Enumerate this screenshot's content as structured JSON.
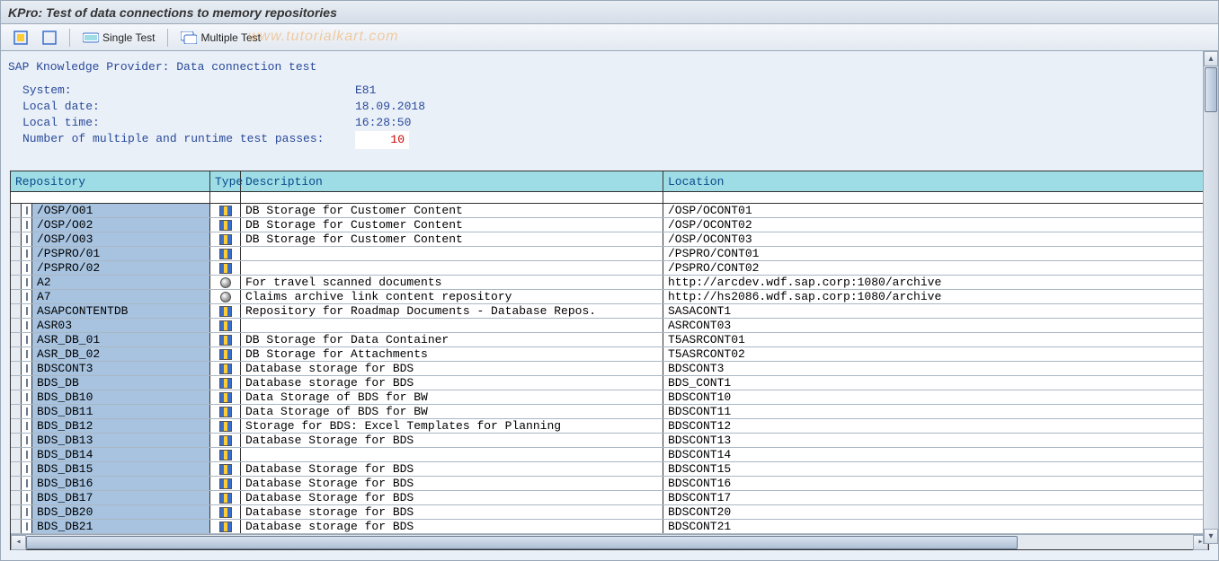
{
  "title": "KPro: Test of data connections to memory repositories",
  "watermark": "www.tutorialkart.com",
  "toolbar": {
    "single": "Single Test",
    "multiple": "Multiple Test"
  },
  "section_title": "SAP Knowledge Provider: Data connection test",
  "info": {
    "system_label": "System:",
    "system_value": "E81",
    "date_label": "Local date:",
    "date_value": "18.09.2018",
    "time_label": "Local time:",
    "time_value": "16:28:50",
    "passes_label": "Number of multiple and runtime test passes:",
    "passes_value": "10"
  },
  "columns": {
    "repo": "Repository",
    "type": "Type",
    "desc": "Description",
    "loc": "Location"
  },
  "rows": [
    {
      "repo": "/OSP/O01",
      "type": "db",
      "desc": "DB Storage for Customer Content",
      "loc": "/OSP/OCONT01"
    },
    {
      "repo": "/OSP/O02",
      "type": "db",
      "desc": "DB Storage for Customer Content",
      "loc": "/OSP/OCONT02"
    },
    {
      "repo": "/OSP/O03",
      "type": "db",
      "desc": "DB Storage for Customer Content",
      "loc": "/OSP/OCONT03"
    },
    {
      "repo": "/PSPRO/01",
      "type": "db",
      "desc": "",
      "loc": "/PSPRO/CONT01"
    },
    {
      "repo": "/PSPRO/02",
      "type": "db",
      "desc": "",
      "loc": "/PSPRO/CONT02"
    },
    {
      "repo": "A2",
      "type": "arc",
      "desc": "For travel scanned documents",
      "loc": "http://arcdev.wdf.sap.corp:1080/archive"
    },
    {
      "repo": "A7",
      "type": "arc",
      "desc": "Claims archive link content repository",
      "loc": "http://hs2086.wdf.sap.corp:1080/archive"
    },
    {
      "repo": "ASAPCONTENTDB",
      "type": "db",
      "desc": "Repository for Roadmap Documents - Database Repos.",
      "loc": "SASACONT1"
    },
    {
      "repo": "ASR03",
      "type": "db",
      "desc": "",
      "loc": "ASRCONT03"
    },
    {
      "repo": "ASR_DB_01",
      "type": "db",
      "desc": "DB Storage for Data Container",
      "loc": "T5ASRCONT01"
    },
    {
      "repo": "ASR_DB_02",
      "type": "db",
      "desc": "DB Storage for Attachments",
      "loc": "T5ASRCONT02"
    },
    {
      "repo": "BDSCONT3",
      "type": "db",
      "desc": "Database storage for BDS",
      "loc": "BDSCONT3"
    },
    {
      "repo": "BDS_DB",
      "type": "db",
      "desc": "Database storage for BDS",
      "loc": "BDS_CONT1"
    },
    {
      "repo": "BDS_DB10",
      "type": "db",
      "desc": "Data Storage of BDS for BW",
      "loc": "BDSCONT10"
    },
    {
      "repo": "BDS_DB11",
      "type": "db",
      "desc": "Data Storage of BDS for BW",
      "loc": "BDSCONT11"
    },
    {
      "repo": "BDS_DB12",
      "type": "db",
      "desc": "Storage for BDS: Excel Templates for Planning",
      "loc": "BDSCONT12"
    },
    {
      "repo": "BDS_DB13",
      "type": "db",
      "desc": "Database Storage for BDS",
      "loc": "BDSCONT13"
    },
    {
      "repo": "BDS_DB14",
      "type": "db",
      "desc": "",
      "loc": "BDSCONT14"
    },
    {
      "repo": "BDS_DB15",
      "type": "db",
      "desc": "Database Storage for BDS",
      "loc": "BDSCONT15"
    },
    {
      "repo": "BDS_DB16",
      "type": "db",
      "desc": "Database Storage for BDS",
      "loc": "BDSCONT16"
    },
    {
      "repo": "BDS_DB17",
      "type": "db",
      "desc": "Database Storage for BDS",
      "loc": "BDSCONT17"
    },
    {
      "repo": "BDS_DB20",
      "type": "db",
      "desc": "Database storage for BDS",
      "loc": "BDSCONT20"
    },
    {
      "repo": "BDS_DB21",
      "type": "db",
      "desc": "Database storage for BDS",
      "loc": "BDSCONT21"
    }
  ]
}
